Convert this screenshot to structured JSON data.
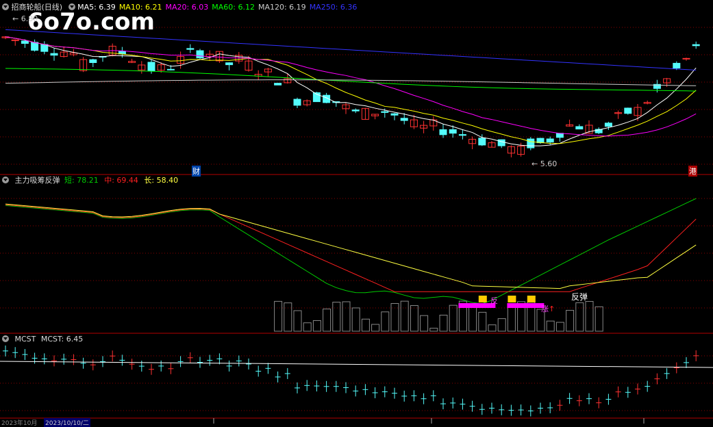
{
  "watermark": "6o7o.com",
  "main_panel": {
    "stock_name": "招商轮船(日线)",
    "ma_legend": [
      {
        "label": "MA5: 6.39",
        "color": "#ffffff"
      },
      {
        "label": "MA10: 6.21",
        "color": "#ffff00"
      },
      {
        "label": "MA20: 6.03",
        "color": "#ff00ff"
      },
      {
        "label": "MA60: 6.12",
        "color": "#00ff00"
      },
      {
        "label": "MA120: 6.19",
        "color": "#cccccc"
      },
      {
        "label": "MA250: 6.36",
        "color": "#3333ff"
      }
    ],
    "high_label": "6.80",
    "low_label": "5.60",
    "marker_cai": "财",
    "marker_gang": "港"
  },
  "indicator_panel": {
    "name": "主力吸筹反弹",
    "short_label": "短: 78.21",
    "mid_label": "中: 69.44",
    "long_label": "长: 58.40",
    "colors": {
      "short": "#00cc00",
      "mid": "#ff2020",
      "long": "#ffff40"
    },
    "annotation_fan": "反",
    "annotation_fantan": "反弹",
    "annotation_zhang": "涨"
  },
  "mcst_panel": {
    "name": "MCST",
    "value_label": "MCST: 6.45"
  },
  "date_axis": [
    "2023年10月",
    "2023/10/10/二"
  ],
  "colors": {
    "up": "#ff3232",
    "down": "#54fcfc",
    "grid": "#8b0000",
    "border": "#b40000"
  }
}
